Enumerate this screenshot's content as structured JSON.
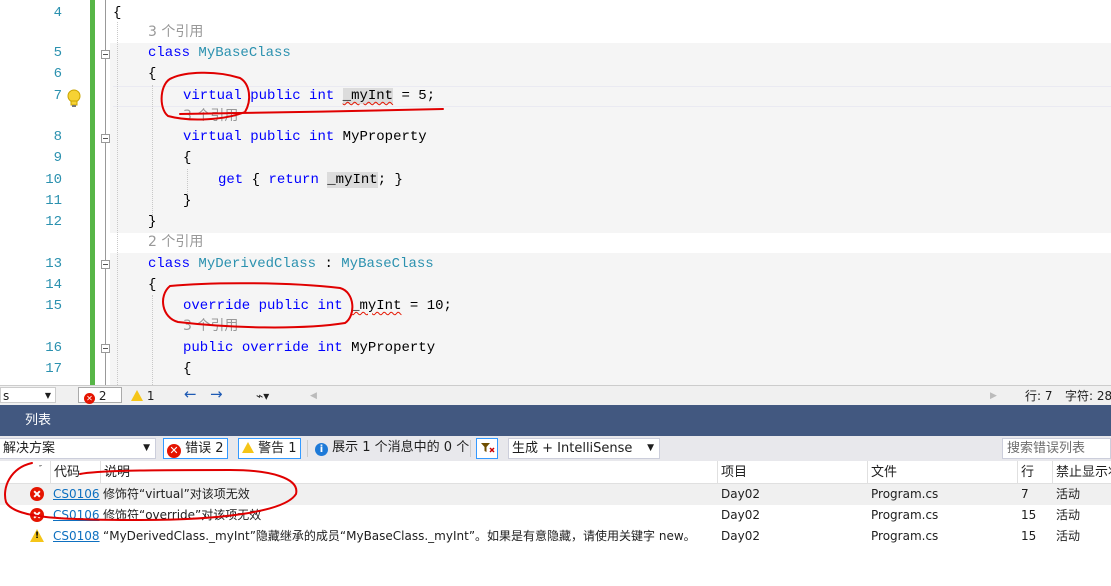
{
  "editor": {
    "lines": [
      {
        "n": "4",
        "text": "{"
      },
      {
        "lens": "3 个引用"
      },
      {
        "n": "5",
        "kw1": "class",
        "type": "MyBaseClass"
      },
      {
        "n": "6",
        "text": "{"
      },
      {
        "n": "7",
        "kw1": "virtual",
        "kw2": "public",
        "kw3": "int",
        "ident": "_myInt",
        "rest": " = 5;"
      },
      {
        "lens": "3 个引用"
      },
      {
        "n": "8",
        "kw1": "virtual",
        "kw2": "public",
        "kw3": "int",
        "ident": "MyProperty"
      },
      {
        "n": "9",
        "text": "{"
      },
      {
        "n": "10",
        "kw1": "get",
        "open": " { ",
        "kw2": "return",
        "ident": "_myInt",
        "rest": "; }"
      },
      {
        "n": "11",
        "text": "}"
      },
      {
        "n": "12",
        "text": "}"
      },
      {
        "lens": "2 个引用"
      },
      {
        "n": "13",
        "kw1": "class",
        "type": "MyDerivedClass",
        "colon": " : ",
        "base": "MyBaseClass"
      },
      {
        "n": "14",
        "text": "{"
      },
      {
        "n": "15",
        "kw1": "override",
        "kw2": "public",
        "kw3": "int",
        "ident": "_myInt",
        "rest": " = 10;"
      },
      {
        "lens": "3 个引用"
      },
      {
        "n": "16",
        "kw1": "public",
        "kw2": "override",
        "kw3": "int",
        "ident": "MyProperty"
      },
      {
        "n": "17",
        "text": "{"
      }
    ]
  },
  "status_strip": {
    "left_combo": "s",
    "errors": "2",
    "warnings": "1",
    "line": "行: 7",
    "char": "字符: 28"
  },
  "panel": {
    "title": "列表",
    "scope": "解决方案",
    "errors_btn": "错误 2",
    "warnings_btn": "警告 1",
    "messages_btn": "展示 1 个消息中的 0 个",
    "build_filter": "生成 + IntelliSense",
    "search_placeholder": "搜索错误列表",
    "columns": [
      "代码",
      "说明",
      "项目",
      "文件",
      "行",
      "禁止显示状态"
    ],
    "rows": [
      {
        "severity": "error",
        "code": "CS0106",
        "desc": "修饰符“virtual”对该项无效",
        "project": "Day02",
        "file": "Program.cs",
        "line": "7",
        "state": "活动"
      },
      {
        "severity": "error",
        "code": "CS0106",
        "desc": "修饰符“override”对该项无效",
        "project": "Day02",
        "file": "Program.cs",
        "line": "15",
        "state": "活动"
      },
      {
        "severity": "warning",
        "code": "CS0108",
        "desc": "“MyDerivedClass._myInt”隐藏继承的成员“MyBaseClass._myInt”。如果是有意隐藏，请使用关键字 new。",
        "project": "Day02",
        "file": "Program.cs",
        "line": "15",
        "state": "活动"
      }
    ]
  },
  "colors": {
    "keyword": "#0000ff",
    "type": "#2b91af",
    "error": "#e51400",
    "annotation": "#e00000",
    "panel_title": "#425880"
  }
}
